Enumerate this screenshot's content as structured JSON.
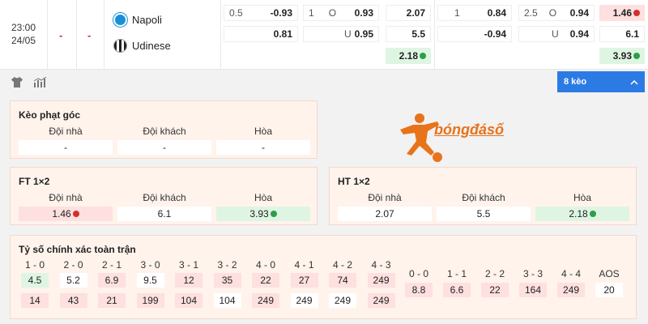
{
  "match": {
    "time": "23:00",
    "date": "24/05",
    "dash1": "-",
    "dash2": "-",
    "home": "Napoli",
    "away": "Udinese"
  },
  "odds": {
    "ah_line": "0.5",
    "ah_home": "-0.93",
    "ah_away": "0.81",
    "ou_line": "1",
    "ou_o_label": "O",
    "ou_u_label": "U",
    "ou_over": "0.93",
    "ou_under": "0.95",
    "x1_home": "2.07",
    "x1_away": "5.5",
    "x1_draw": "2.18",
    "h1_line": "1",
    "h1_home": "0.84",
    "h1_away": "-0.94",
    "h1ou_line": "2.5",
    "h1ou_o": "O",
    "h1ou_u": "U",
    "h1ou_over": "0.94",
    "h1ou_under": "0.94",
    "h1x_home": "1.46",
    "h1x_away": "6.1",
    "h1x_draw": "3.93"
  },
  "toolbar": {
    "keo_label": "8 kèo"
  },
  "corner": {
    "title": "Kèo phạt góc",
    "cols": [
      "Đội nhà",
      "Đội khách",
      "Hòa"
    ],
    "vals": [
      "-",
      "-",
      "-"
    ]
  },
  "ft": {
    "title": "FT 1×2",
    "cols": [
      "Đội nhà",
      "Đội khách",
      "Hòa"
    ],
    "vals": [
      "1.46",
      "6.1",
      "3.93"
    ]
  },
  "ht": {
    "title": "HT 1×2",
    "cols": [
      "Đội nhà",
      "Đội khách",
      "Hòa"
    ],
    "vals": [
      "2.07",
      "5.5",
      "2.18"
    ]
  },
  "brand": {
    "text": "bóngđásố"
  },
  "scores": {
    "title": "Tỷ số chính xác toàn trận",
    "heads": [
      "1 - 0",
      "2 - 0",
      "2 - 1",
      "3 - 0",
      "3 - 1",
      "3 - 2",
      "4 - 0",
      "4 - 1",
      "4 - 2",
      "4 - 3"
    ],
    "row1": [
      "4.5",
      "5.2",
      "6.9",
      "9.5",
      "12",
      "35",
      "22",
      "27",
      "74",
      "249"
    ],
    "row2": [
      "14",
      "43",
      "21",
      "199",
      "104",
      "104",
      "249",
      "249",
      "249",
      "249"
    ],
    "draw_heads": [
      "0 - 0",
      "1 - 1",
      "2 - 2",
      "3 - 3",
      "4 - 4",
      "AOS"
    ],
    "draw_vals": [
      "8.8",
      "6.6",
      "22",
      "164",
      "249",
      "20"
    ]
  },
  "colors": {
    "accent": "#2c7be5",
    "down": "#d0312d",
    "up": "#2c9e4a",
    "panel_bg": "#fff3ec"
  }
}
